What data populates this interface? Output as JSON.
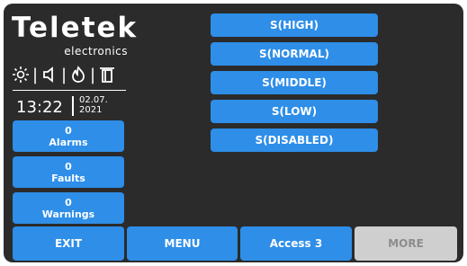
{
  "logo": {
    "brand": "Teletek",
    "sub": "electronics"
  },
  "status_icons": [
    "brightness-icon",
    "speaker-icon",
    "fire-icon",
    "door-icon"
  ],
  "clock": {
    "time": "13:22",
    "date_line1": "02.07.",
    "date_line2": "2021"
  },
  "status": {
    "alarms": {
      "count": "0",
      "label": "Alarms"
    },
    "faults": {
      "count": "0",
      "label": "Faults"
    },
    "warnings": {
      "count": "0",
      "label": "Warnings"
    }
  },
  "sensitivity_options": [
    "S(HIGH)",
    "S(NORMAL)",
    "S(MIDDLE)",
    "S(LOW)",
    "S(DISABLED)"
  ],
  "bottom_bar": {
    "exit": "EXIT",
    "menu": "MENU",
    "access": "Access 3",
    "more": "MORE"
  },
  "colors": {
    "screen_bg": "#2b2b2b",
    "accent_blue": "#2e8ee8",
    "disabled_gray": "#cfcfcf"
  }
}
